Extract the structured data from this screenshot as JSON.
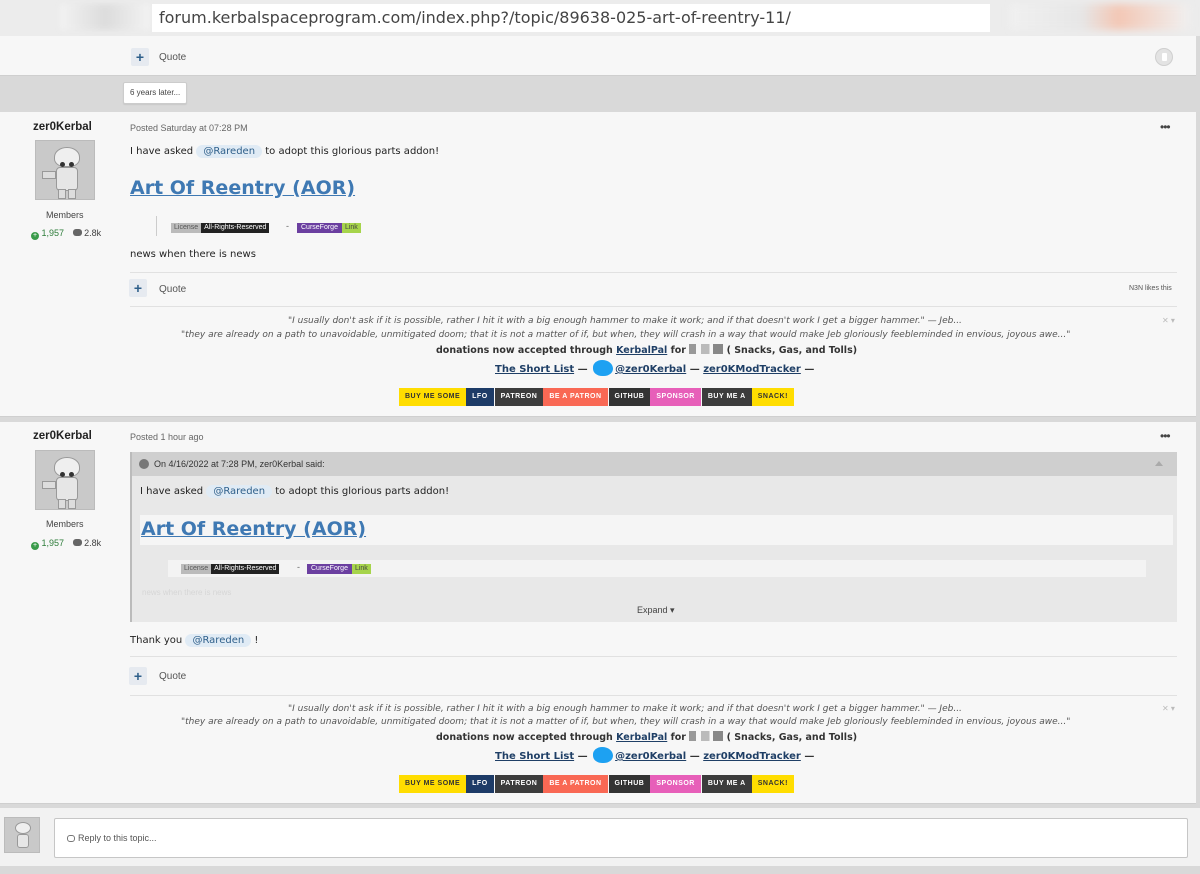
{
  "browser": {
    "url": "forum.kerbalspaceprogram.com/index.php?/topic/89638-025-art-of-reentry-11/"
  },
  "top_post_footer": {
    "plus": "+",
    "quote": "Quote"
  },
  "time_gap": "6 years later...",
  "posts": [
    {
      "author": "zer0Kerbal",
      "role": "Members",
      "reputation": "1,957",
      "post_count": "2.8k",
      "posted": "Posted Saturday at 07:28 PM",
      "menu": "•••",
      "text_before": "I have asked",
      "mention": "@Rareden",
      "text_after": "to adopt this glorious parts addon!",
      "title": "Art Of Reentry (AOR)",
      "license_label": "License",
      "license_value": "All-Rights-Reserved",
      "dash": "-",
      "curseforge": "CurseForge",
      "curseforge_link": "Link",
      "extra": "news when there is news",
      "plus": "+",
      "quote": "Quote",
      "likes": "N3N likes this"
    },
    {
      "author": "zer0Kerbal",
      "role": "Members",
      "reputation": "1,957",
      "post_count": "2.8k",
      "posted": "Posted 1 hour ago",
      "menu": "•••",
      "quote_header": "On 4/16/2022 at 7:28 PM, zer0Kerbal said:",
      "quote_text_before": "I have asked",
      "quote_mention": "@Rareden",
      "quote_text_after": "to adopt this glorious parts addon!",
      "quote_title": "Art Of Reentry (AOR)",
      "quote_license_label": "License",
      "quote_license_value": "All-Rights-Reserved",
      "quote_dash": "-",
      "quote_curseforge": "CurseForge",
      "quote_curseforge_link": "Link",
      "quote_faded": "news when there is news",
      "expand": "Expand ▾",
      "reply_before": "Thank you",
      "reply_mention": "@Rareden",
      "reply_after": "!",
      "plus": "+",
      "quote": "Quote"
    }
  ],
  "signature": {
    "quote1": "\"I usually don't ask if it is possible, rather I hit it with a big enough hammer to make it work; and if that doesn't work I get a bigger hammer.\"  — Jeb...",
    "quote2": "\"they are already on a path to unavoidable, unmitigated doom; that it is not a matter of if, but when, they will crash in a way that would make Jeb gloriously feebleminded in envious, joyous awe...\"",
    "donations_before": "donations now accepted through",
    "donations_link": "KerbalPal",
    "donations_for": "for",
    "donations_after": "( Snacks, Gas, and Tolls)",
    "short_list": "The Short List",
    "sep1": " — ",
    "twitter": "@zer0Kerbal",
    "sep2": "  — ",
    "mod_tracker": "zer0KModTracker",
    "sep3": " —",
    "close": "✕ ▾",
    "buttons": [
      "BUY ME SOME",
      "LFO",
      "PATREON",
      "BE A PATRON",
      "GITHUB",
      "SPONSOR",
      "BUY ME A",
      "SNACK!"
    ]
  },
  "reply": {
    "placeholder": "Reply to this topic..."
  },
  "colors": {
    "link": "#3f79b3",
    "mention_bg": "#e0ebf5",
    "card_bg": "#f7f7f7",
    "page_bg": "#d9d9d9"
  }
}
